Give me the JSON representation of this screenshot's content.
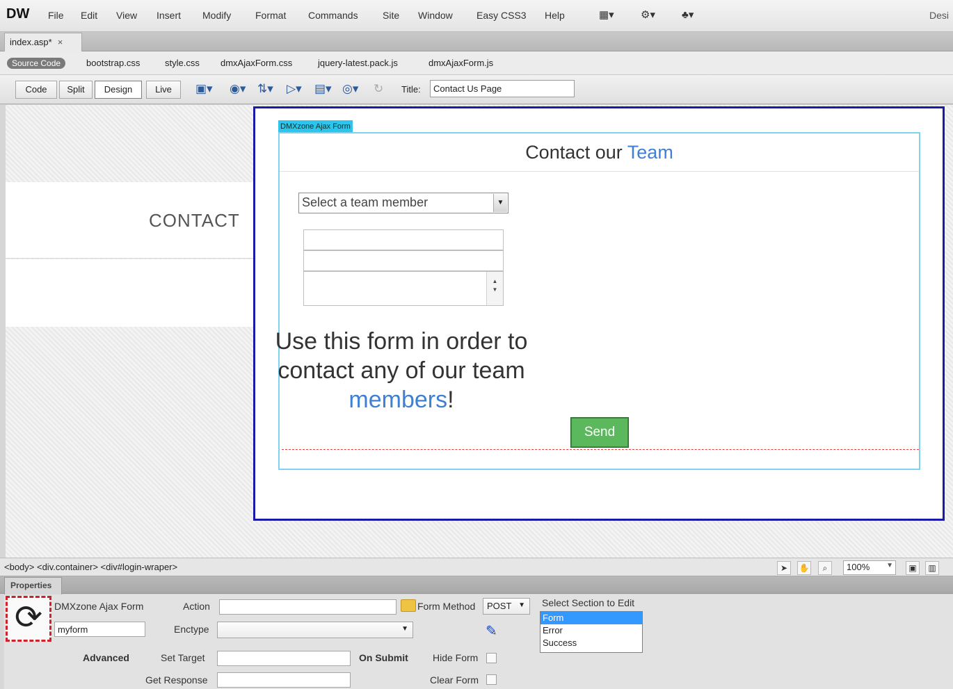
{
  "app": {
    "logo": "DW",
    "menu": [
      "File",
      "Edit",
      "View",
      "Insert",
      "Modify",
      "Format",
      "Commands",
      "Site",
      "Window",
      "Easy CSS3",
      "Help"
    ],
    "workspace_label": "Desi",
    "toolbar_icons": [
      "layout-icon",
      "gear-icon",
      "site-icon"
    ]
  },
  "document": {
    "tab_name": "index.asp*",
    "tab_close": "×"
  },
  "related_files": {
    "source_code": "Source Code",
    "files": [
      "bootstrap.css",
      "style.css",
      "dmxAjaxForm.css",
      "jquery-latest.pack.js",
      "dmxAjaxForm.js"
    ]
  },
  "view_toolbar": {
    "code": "Code",
    "split": "Split",
    "design": "Design",
    "live": "Live",
    "title_label": "Title:",
    "title_value": "Contact Us Page"
  },
  "design": {
    "contact_heading": "CONTACT",
    "form_label": "DMXzone Ajax Form",
    "form_heading_pre": "Contact our ",
    "form_heading_accent": "Team",
    "select_placeholder": "Select a team member",
    "intro_line1": "Use this form in order to",
    "intro_line2": "contact any of our team",
    "intro_accent": "members",
    "intro_end": "!",
    "send": "Send"
  },
  "statusbar": {
    "tag_selector": "<body> <div.container> <div#login-wraper>",
    "zoom": "100%"
  },
  "properties": {
    "tab": "Properties",
    "component": "DMXzone Ajax Form",
    "form_name": "myform",
    "action_label": "Action",
    "action_value": "",
    "enctype_label": "Enctype",
    "enctype_value": "",
    "form_method_label": "Form Method",
    "form_method_value": "POST",
    "select_section_label": "Select Section to Edit",
    "sections": [
      "Form",
      "Error",
      "Success"
    ],
    "advanced": "Advanced",
    "set_target_label": "Set Target",
    "set_target_value": "",
    "get_response_label": "Get Response",
    "get_response_value": "",
    "on_submit": "On Submit",
    "hide_form": "Hide Form",
    "clear_form": "Clear Form"
  },
  "colors": {
    "accent_blue": "#3f7fd4",
    "send_green": "#5cb85c",
    "wrapper_border": "#1a1aa8",
    "form_border": "#7fd3ee"
  }
}
